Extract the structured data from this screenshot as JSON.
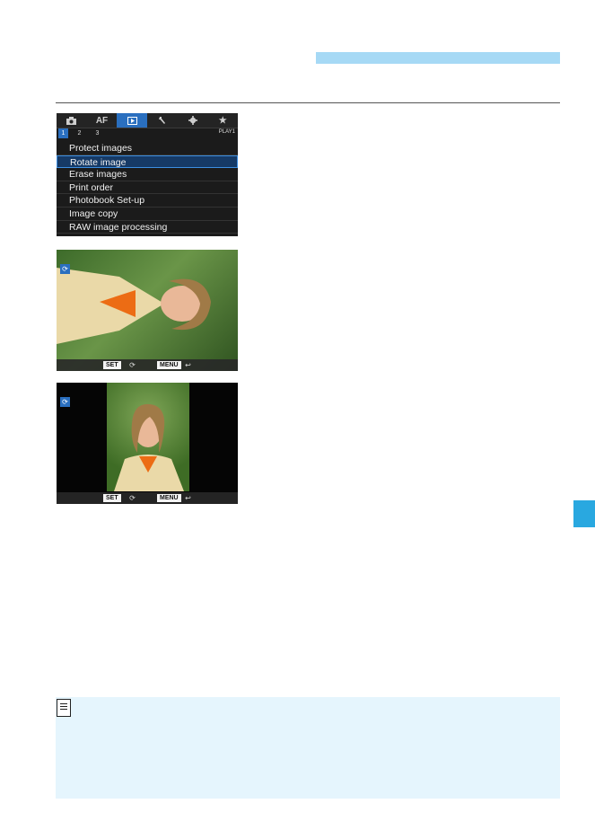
{
  "menu_screen": {
    "tabs": [
      {
        "name": "shooting-tab",
        "label": "",
        "icon": "camera-icon"
      },
      {
        "name": "af-tab",
        "label": "AF"
      },
      {
        "name": "playback-tab",
        "label": "",
        "icon": "play-icon"
      },
      {
        "name": "setup-tab",
        "label": "",
        "icon": "wrench-icon"
      },
      {
        "name": "custom-tab",
        "label": "",
        "icon": "gear-icon"
      },
      {
        "name": "mymenu-tab",
        "label": "★"
      }
    ],
    "subtabs": [
      "1",
      "2",
      "3"
    ],
    "page_label": "PLAY1",
    "items": [
      "Protect images",
      "Rotate image",
      "Erase images",
      "Print order",
      "Photobook Set-up",
      "Image copy",
      "RAW image processing"
    ],
    "selected_index": 1
  },
  "controls": {
    "set_label": "SET",
    "menu_label": "MENU"
  },
  "colors": {
    "accent_blue": "#29a8e0",
    "header_bar": "#a6d9f5",
    "note_bg": "#e5f5fd",
    "menu_highlight": "#3d8ee0"
  }
}
